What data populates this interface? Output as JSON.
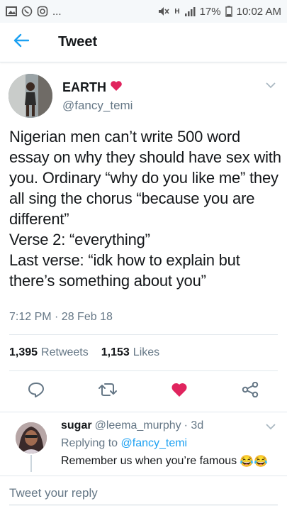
{
  "status_bar": {
    "notification_icons": [
      "image-icon",
      "whatsapp-icon",
      "instagram-icon"
    ],
    "more": "...",
    "network": "H",
    "battery": "17%",
    "time": "10:02 AM"
  },
  "app_bar": {
    "title": "Tweet"
  },
  "tweet": {
    "author_name": "EARTH",
    "author_handle": "@fancy_temi",
    "text": "Nigerian men can’t write 500 word essay on why they should have sex with you. Ordinary “why do you like me” they all sing the chorus “because you are different”\nVerse 2: “everything”\nLast verse: “idk how to explain but there’s something about you”",
    "timestamp": "7:12 PM · 28 Feb 18",
    "retweets_count": "1,395",
    "retweets_label": "Retweets",
    "likes_count": "1,153",
    "likes_label": "Likes"
  },
  "reply": {
    "name": "sugar",
    "handle": "@leema_murphy",
    "age": "· 3d",
    "replying_label": "Replying to",
    "replying_mention": "@fancy_temi",
    "text": "Remember us when you’re famous",
    "emojis": "😂😂"
  },
  "composer": {
    "placeholder": "Tweet your reply"
  },
  "colors": {
    "accent": "#1da1f2",
    "like": "#e0245e",
    "text": "#14171a",
    "muted": "#657786"
  }
}
